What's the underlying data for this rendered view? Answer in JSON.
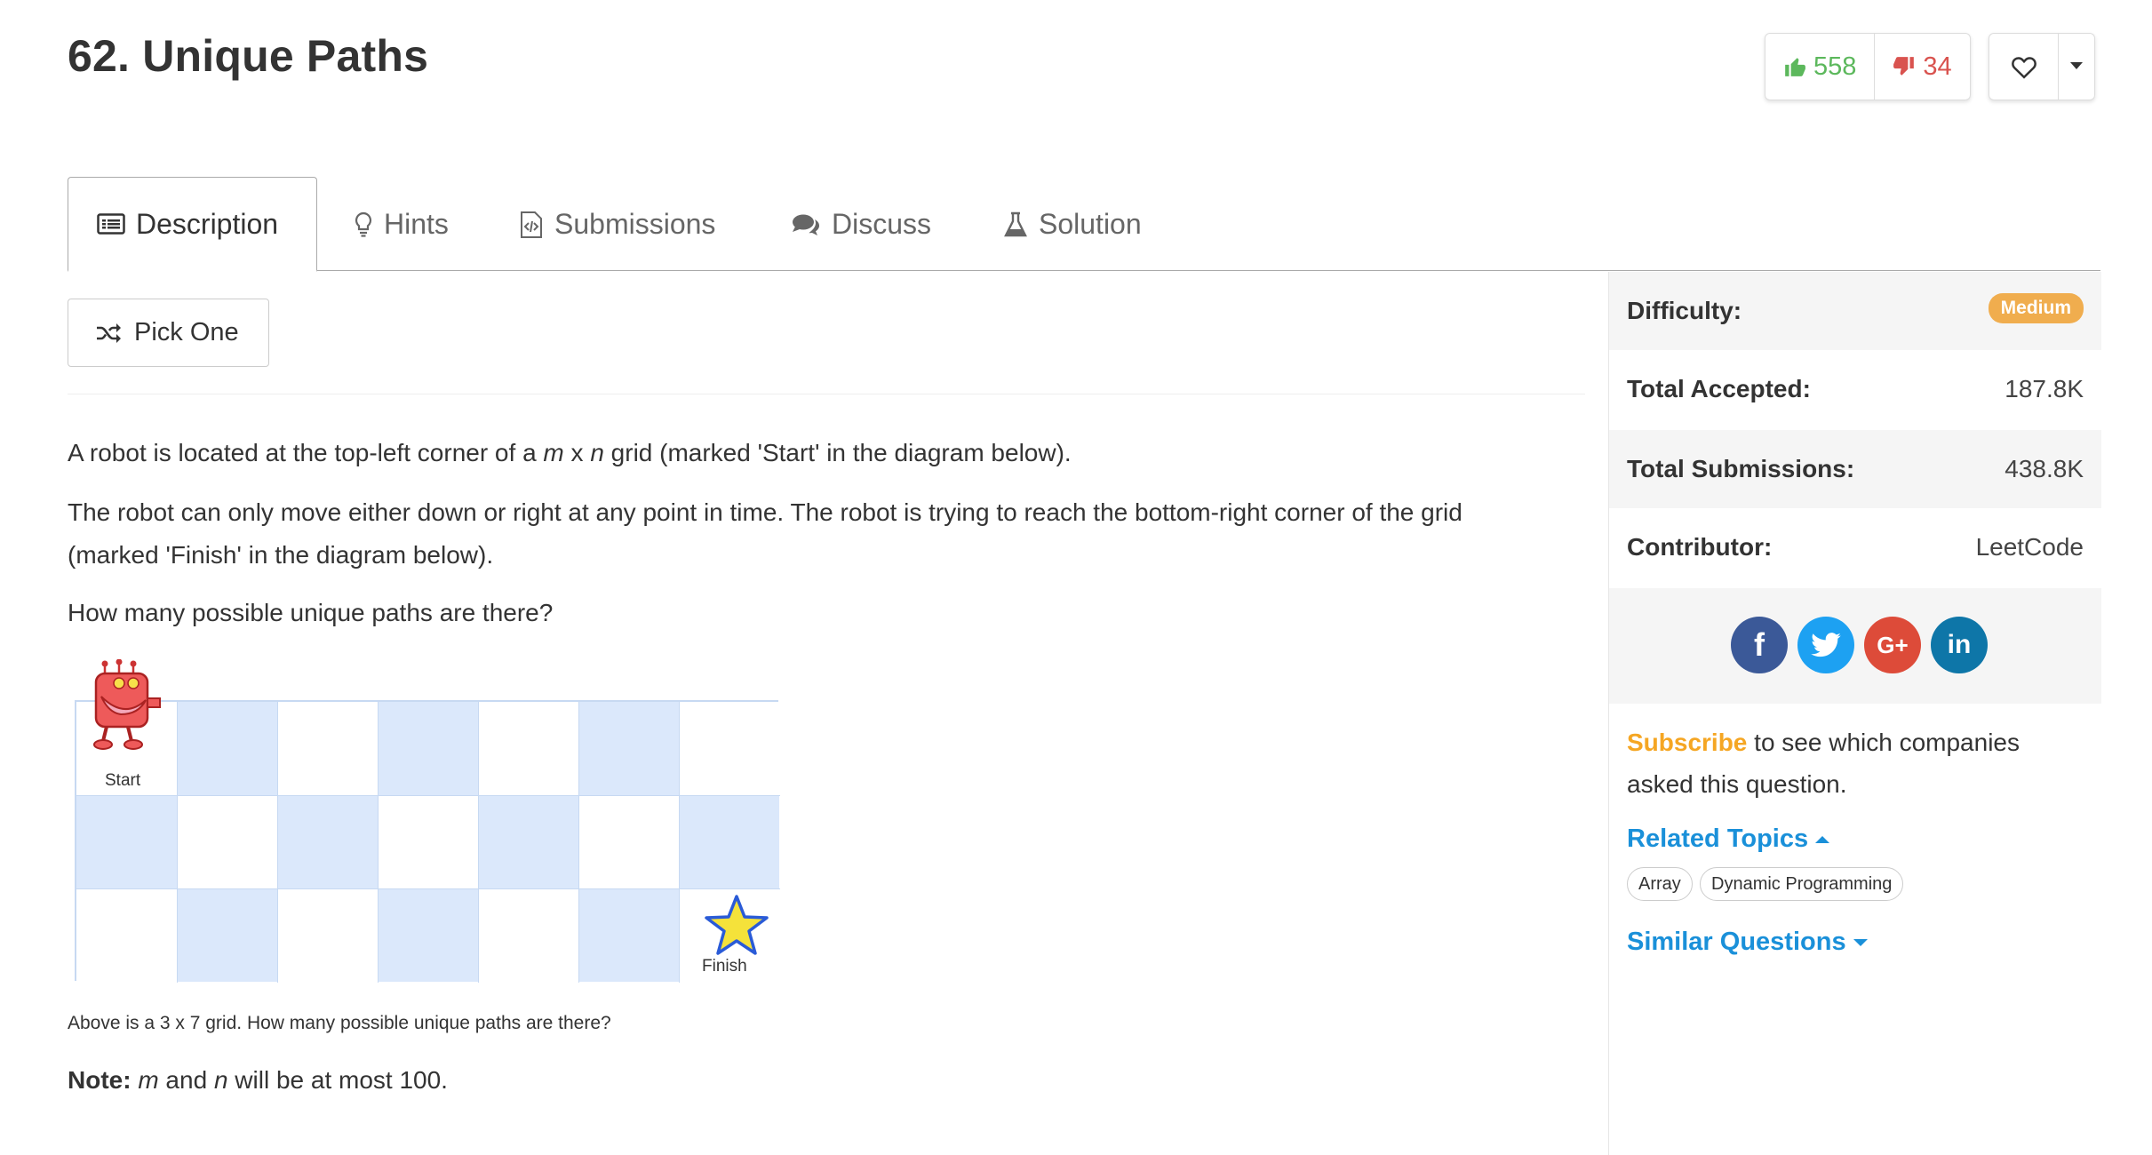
{
  "problem": {
    "title": "62. Unique Paths"
  },
  "votes": {
    "up": "558",
    "down": "34"
  },
  "tabs": [
    {
      "label": "Description"
    },
    {
      "label": "Hints"
    },
    {
      "label": "Submissions"
    },
    {
      "label": "Discuss"
    },
    {
      "label": "Solution"
    }
  ],
  "pick_one": "Pick One",
  "description": {
    "p1_a": "A robot is located at the top-left corner of a ",
    "p1_m": "m",
    "p1_x": " x ",
    "p1_n": "n",
    "p1_b": " grid (marked 'Start' in the diagram below).",
    "p2": "The robot can only move either down or right at any point in time. The robot is trying to reach the bottom-right corner of the grid (marked 'Finish' in the diagram below).",
    "p3": "How many possible unique paths are there?",
    "caption": "Above is a 3 x 7 grid. How many possible unique paths are there?",
    "note_label": "Note:",
    "note_m": "m",
    "note_and": " and ",
    "note_n": "n",
    "note_rest": " will be at most 100."
  },
  "diagram": {
    "start_label": "Start",
    "finish_label": "Finish"
  },
  "sidebar": {
    "difficulty_label": "Difficulty:",
    "difficulty_value": "Medium",
    "accepted_label": "Total Accepted:",
    "accepted_value": "187.8K",
    "submissions_label": "Total Submissions:",
    "submissions_value": "438.8K",
    "contributor_label": "Contributor:",
    "contributor_value": "LeetCode",
    "subscribe_link": "Subscribe",
    "subscribe_text": " to see which companies asked this question.",
    "related_topics": "Related Topics",
    "topics": [
      "Array",
      "Dynamic Programming"
    ],
    "similar_questions": "Similar Questions",
    "social": [
      "f",
      "G+",
      "in"
    ]
  },
  "colors": {
    "upvote": "#5cb85c",
    "downvote": "#d9534f",
    "badge": "#f0ad4e",
    "link": "#1a90d9",
    "subscribe": "#f5a623",
    "facebook": "#3b5998",
    "twitter": "#1da1f2",
    "google": "#dd4b39",
    "linkedin": "#0e76a8"
  }
}
